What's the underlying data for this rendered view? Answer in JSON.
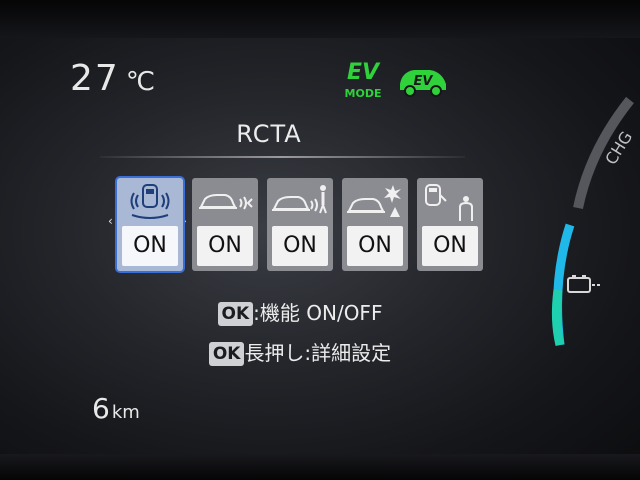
{
  "temperature": {
    "value": "27",
    "unit": "℃"
  },
  "ev_indicator": {
    "ev": "EV",
    "mode": "MODE"
  },
  "ev_icon_label": "EV",
  "title": "RCTA",
  "tiles": [
    {
      "icon": "rcta-sensor-icon",
      "label": "ON",
      "selected": true
    },
    {
      "icon": "car-rear-sound-icon",
      "label": "ON",
      "selected": false
    },
    {
      "icon": "car-pedestrian-icon",
      "label": "ON",
      "selected": false
    },
    {
      "icon": "car-collision-icon",
      "label": "ON",
      "selected": false
    },
    {
      "icon": "car-door-icon",
      "label": "ON",
      "selected": false
    }
  ],
  "help": {
    "line1_key": "OK",
    "line1_text": ":機能 ON/OFF",
    "line2_key": "OK",
    "line2_text": "長押し:詳細設定"
  },
  "odometer": {
    "value": "6",
    "unit": "km"
  },
  "gauge": {
    "label": "CHG",
    "accent_color": "#20b8e8"
  },
  "colors": {
    "ev_green": "#2fd23a",
    "selection_blue": "#3a6fd8"
  }
}
